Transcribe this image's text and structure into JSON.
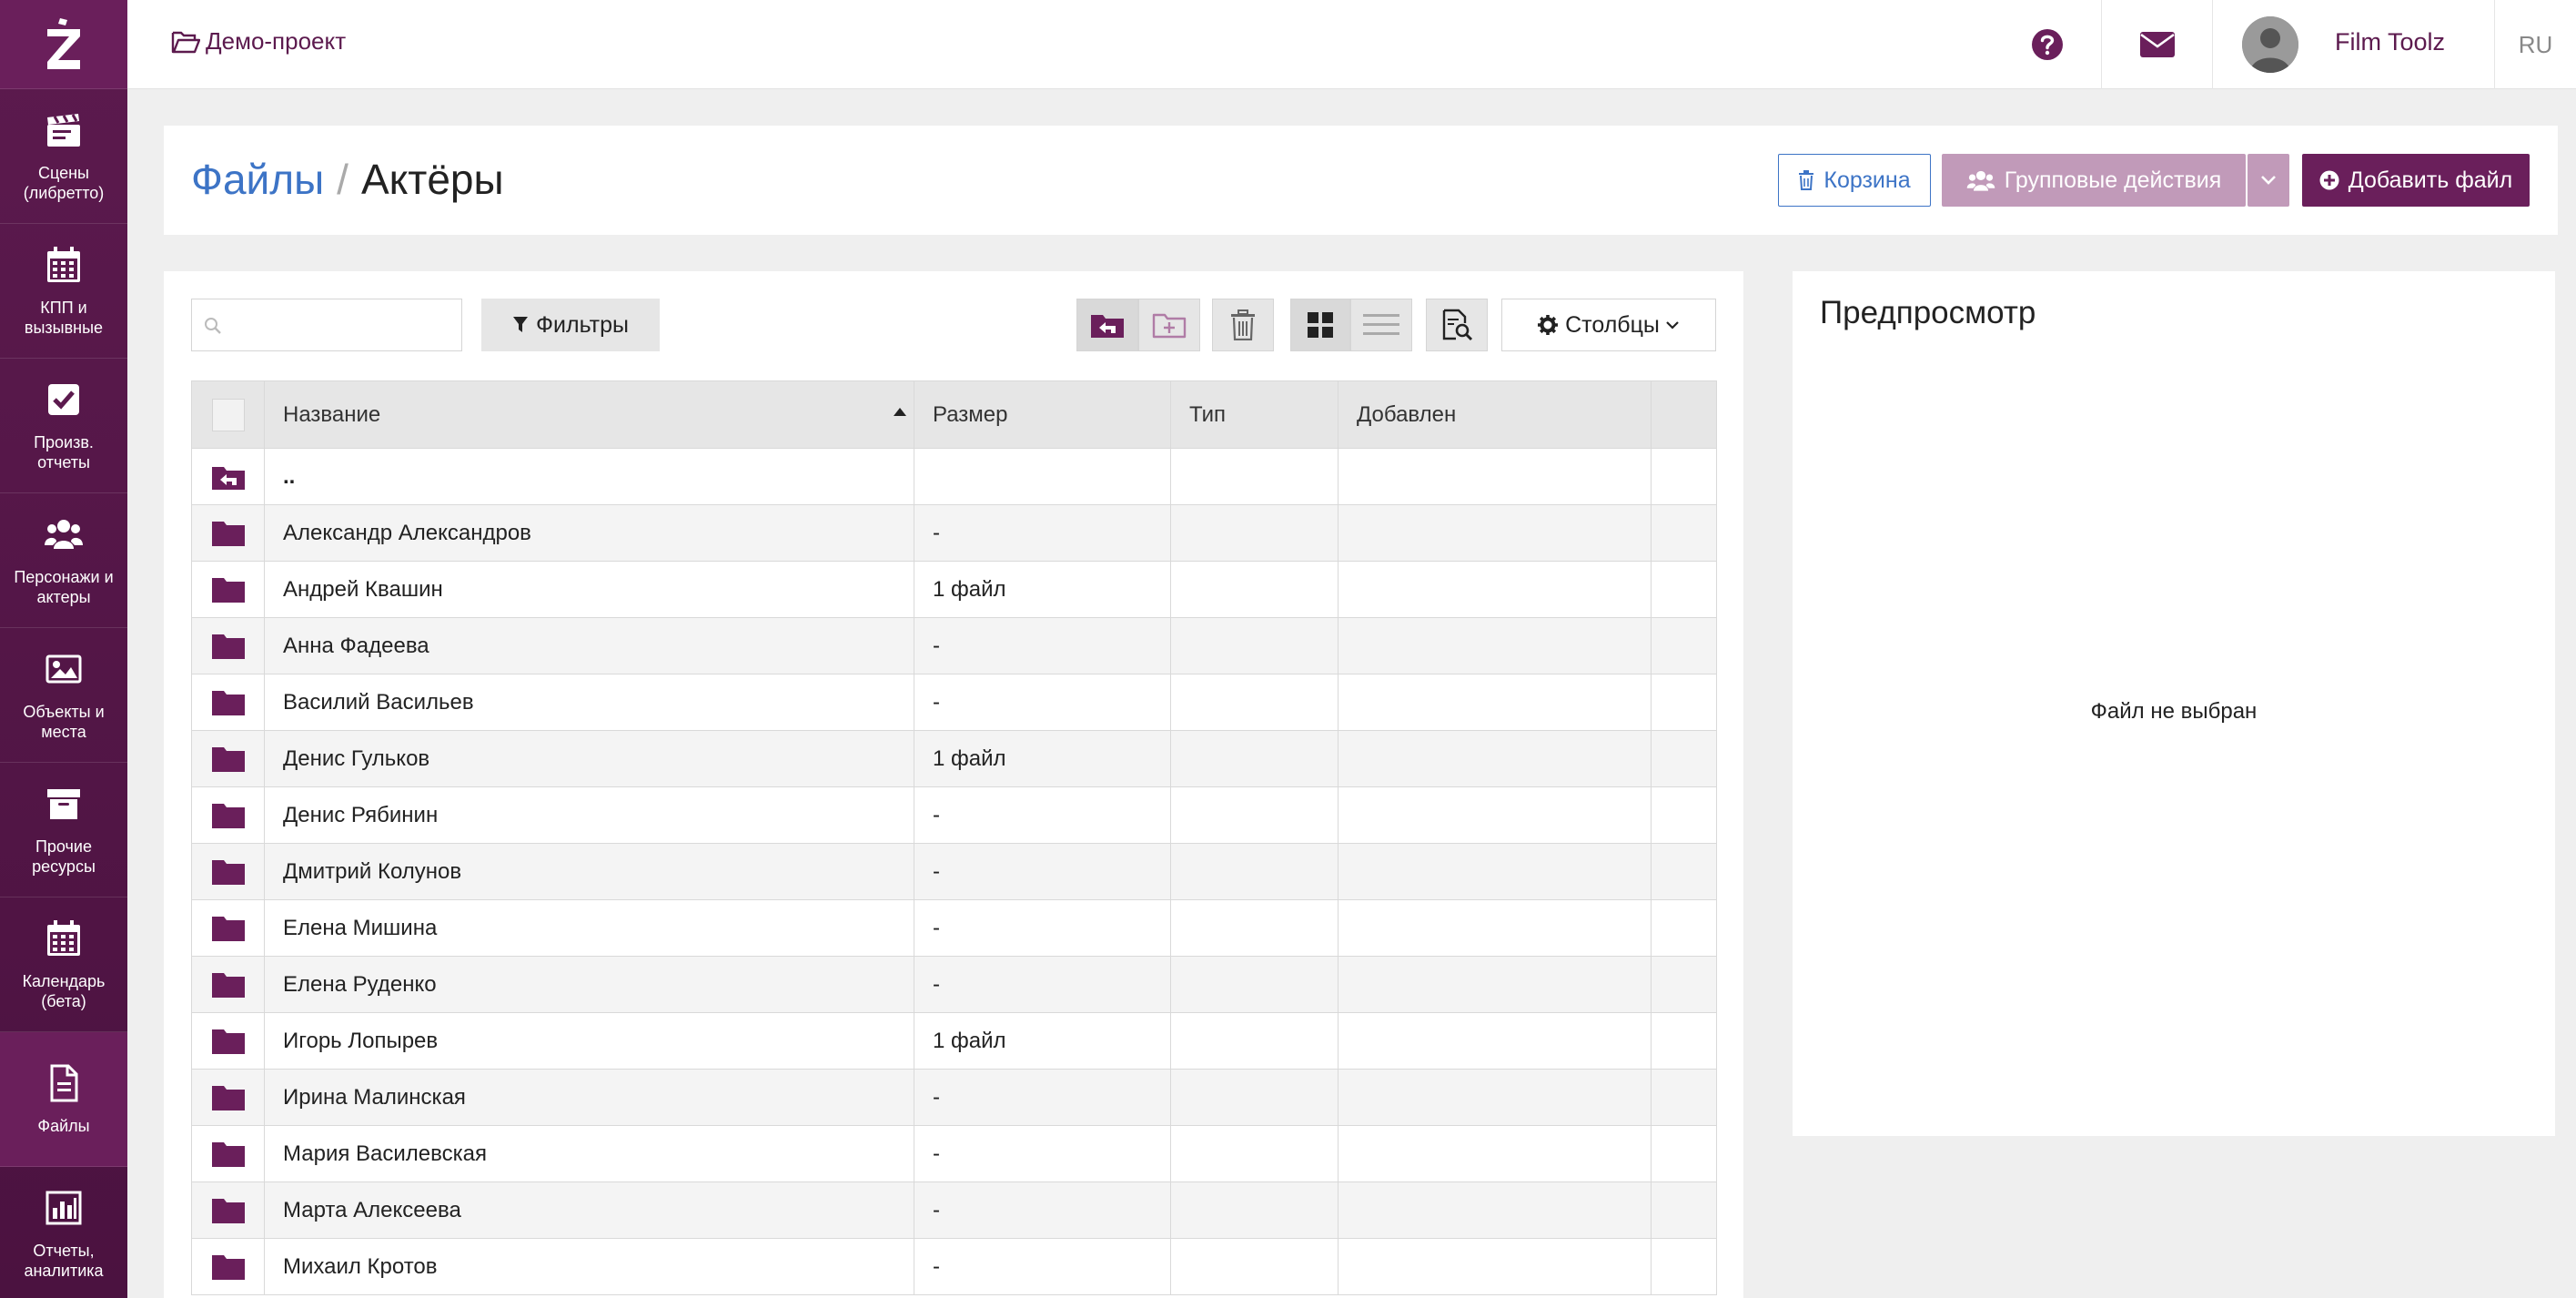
{
  "sidebar": {
    "logo": "Z",
    "items": [
      {
        "label": "Сцены (либретто)",
        "icon": "clapperboard-icon"
      },
      {
        "label": "КПП и вызывные",
        "icon": "calendar-icon"
      },
      {
        "label": "Произв. отчеты",
        "icon": "checkbox-icon"
      },
      {
        "label": "Персонажи и актеры",
        "icon": "users-icon"
      },
      {
        "label": "Объекты и места",
        "icon": "image-icon"
      },
      {
        "label": "Прочие ресурсы",
        "icon": "archive-icon"
      },
      {
        "label": "Календарь (бета)",
        "icon": "calendar-icon"
      },
      {
        "label": "Файлы",
        "icon": "file-icon"
      },
      {
        "label": "Отчеты, аналитика",
        "icon": "bar-chart-icon"
      }
    ]
  },
  "topbar": {
    "project": "Демо-проект",
    "user_name": "Film Toolz",
    "lang": "RU"
  },
  "header": {
    "crumb_root": "Файлы",
    "crumb_sep": "/",
    "crumb_current": "Актёры",
    "trash_label": "Корзина",
    "group_label": "Групповые действия",
    "add_label": "Добавить файл"
  },
  "toolbar": {
    "search_placeholder": "",
    "filters_label": "Фильтры",
    "columns_label": "Столбцы"
  },
  "table": {
    "columns": [
      "Название",
      "Размер",
      "Тип",
      "Добавлен"
    ],
    "up_row": "..",
    "rows": [
      {
        "name": "Александр Александров",
        "size": "-"
      },
      {
        "name": "Андрей Квашин",
        "size": "1 файл"
      },
      {
        "name": "Анна Фадеева",
        "size": "-"
      },
      {
        "name": "Василий Васильев",
        "size": "-"
      },
      {
        "name": "Денис Гульков",
        "size": "1 файл"
      },
      {
        "name": "Денис Рябинин",
        "size": "-"
      },
      {
        "name": "Дмитрий Колунов",
        "size": "-"
      },
      {
        "name": "Елена Мишина",
        "size": "-"
      },
      {
        "name": "Елена Руденко",
        "size": "-"
      },
      {
        "name": "Игорь Лопырев",
        "size": "1 файл"
      },
      {
        "name": "Ирина Малинская",
        "size": "-"
      },
      {
        "name": "Мария Василевская",
        "size": "-"
      },
      {
        "name": "Марта Алексеева",
        "size": "-"
      },
      {
        "name": "Михаил Кротов",
        "size": "-"
      }
    ]
  },
  "preview": {
    "title": "Предпросмотр",
    "empty": "Файл не выбран"
  },
  "colors": {
    "brand": "#6a1f5b",
    "sidebar": "#5c1a4e",
    "link": "#3d74c6",
    "group_disabled": "#c19ab9"
  }
}
